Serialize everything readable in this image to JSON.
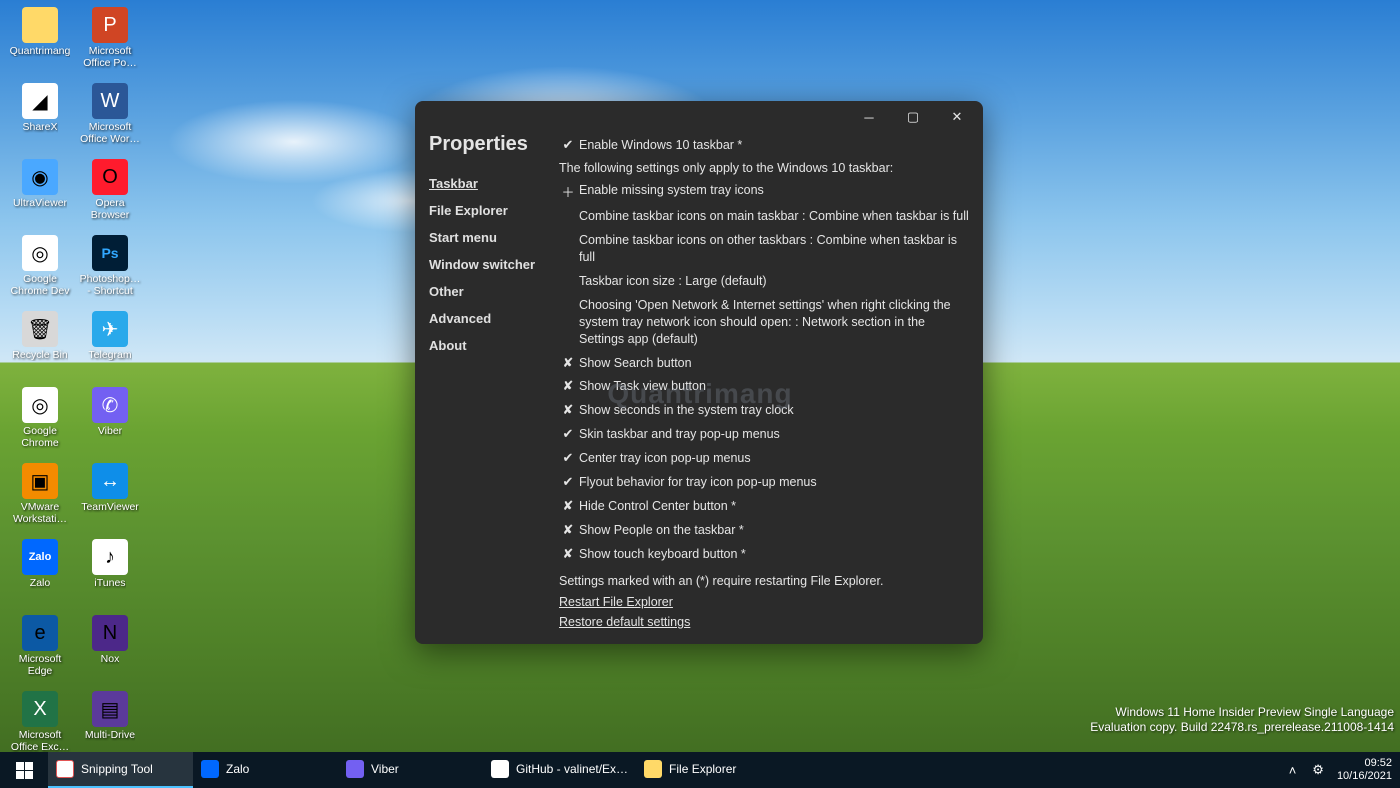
{
  "desktop_icons": [
    {
      "label": "Quantrimang",
      "cls": "folder",
      "glyph": ""
    },
    {
      "label": "Microsoft Office Po…",
      "cls": "ppt",
      "glyph": "P"
    },
    {
      "label": "ShareX",
      "cls": "sharex",
      "glyph": "◢"
    },
    {
      "label": "Microsoft Office Wor…",
      "cls": "word",
      "glyph": "W"
    },
    {
      "label": "UltraViewer",
      "cls": "uv",
      "glyph": "◉"
    },
    {
      "label": "Opera Browser",
      "cls": "opera",
      "glyph": "O"
    },
    {
      "label": "Google Chrome Dev",
      "cls": "chrome",
      "glyph": "◎"
    },
    {
      "label": "Photoshop… - Shortcut",
      "cls": "ps",
      "glyph": "Ps"
    },
    {
      "label": "Recycle Bin",
      "cls": "bin",
      "glyph": "🗑"
    },
    {
      "label": "Telegram",
      "cls": "tele",
      "glyph": "✈"
    },
    {
      "label": "Google Chrome",
      "cls": "chrome",
      "glyph": "◎"
    },
    {
      "label": "Viber",
      "cls": "viber",
      "glyph": "✆"
    },
    {
      "label": "VMware Workstati…",
      "cls": "vmw",
      "glyph": "▣"
    },
    {
      "label": "TeamViewer",
      "cls": "tv",
      "glyph": "↔"
    },
    {
      "label": "Zalo",
      "cls": "zalo",
      "glyph": "Zalo"
    },
    {
      "label": "iTunes",
      "cls": "itunes",
      "glyph": "♪"
    },
    {
      "label": "Microsoft Edge",
      "cls": "edge",
      "glyph": "e"
    },
    {
      "label": "Nox",
      "cls": "nox",
      "glyph": "N"
    },
    {
      "label": "Microsoft Office Exc…",
      "cls": "excel",
      "glyph": "X"
    },
    {
      "label": "Multi-Drive",
      "cls": "md",
      "glyph": "▤"
    }
  ],
  "watermark": {
    "line1": "Windows 11 Home Insider Preview Single Language",
    "line2": "Evaluation copy. Build 22478.rs_prerelease.211008-1414"
  },
  "center_watermark": "Quantrimang",
  "window": {
    "title": "Properties",
    "nav": [
      "Taskbar",
      "File Explorer",
      "Start menu",
      "Window switcher",
      "Other",
      "Advanced",
      "About"
    ],
    "active_nav": "Taskbar",
    "settings": [
      {
        "icon": "check",
        "text": "Enable Windows 10 taskbar *"
      },
      {
        "icon": "note",
        "text": "The following settings only apply to the Windows 10 taskbar:"
      },
      {
        "icon": "plus",
        "text": "Enable missing system tray icons"
      },
      {
        "icon": "none",
        "text": "Combine taskbar icons on main taskbar : Combine when taskbar is full"
      },
      {
        "icon": "none",
        "text": "Combine taskbar icons on other taskbars : Combine when taskbar is full"
      },
      {
        "icon": "none",
        "text": "Taskbar icon size : Large (default)"
      },
      {
        "icon": "none",
        "text": "Choosing 'Open Network & Internet settings' when right clicking the system tray network icon should open: : Network section in the Settings app (default)"
      },
      {
        "icon": "cross",
        "text": "Show Search button"
      },
      {
        "icon": "cross",
        "text": "Show Task view button"
      },
      {
        "icon": "cross",
        "text": "Show seconds in the system tray clock"
      },
      {
        "icon": "check",
        "text": "Skin taskbar and tray pop-up menus"
      },
      {
        "icon": "check",
        "text": "Center tray icon pop-up menus"
      },
      {
        "icon": "check",
        "text": "Flyout behavior for tray icon pop-up menus"
      },
      {
        "icon": "cross",
        "text": "Hide Control Center button *"
      },
      {
        "icon": "cross",
        "text": "Show People on the taskbar *"
      },
      {
        "icon": "cross",
        "text": "Show touch keyboard button *"
      }
    ],
    "footnote": "Settings marked with an (*) require restarting File Explorer.",
    "links": [
      "Restart File Explorer",
      "Restore default settings"
    ]
  },
  "taskbar": {
    "items": [
      {
        "label": "Snipping Tool",
        "cls": "snip",
        "active": true
      },
      {
        "label": "Zalo",
        "cls": "zalo",
        "active": false
      },
      {
        "label": "Viber",
        "cls": "viber",
        "active": false
      },
      {
        "label": "GitHub - valinet/Ex…",
        "cls": "gh",
        "active": false
      },
      {
        "label": "File Explorer",
        "cls": "fexp",
        "active": false
      }
    ],
    "time": "09:52",
    "date": "10/16/2021"
  }
}
